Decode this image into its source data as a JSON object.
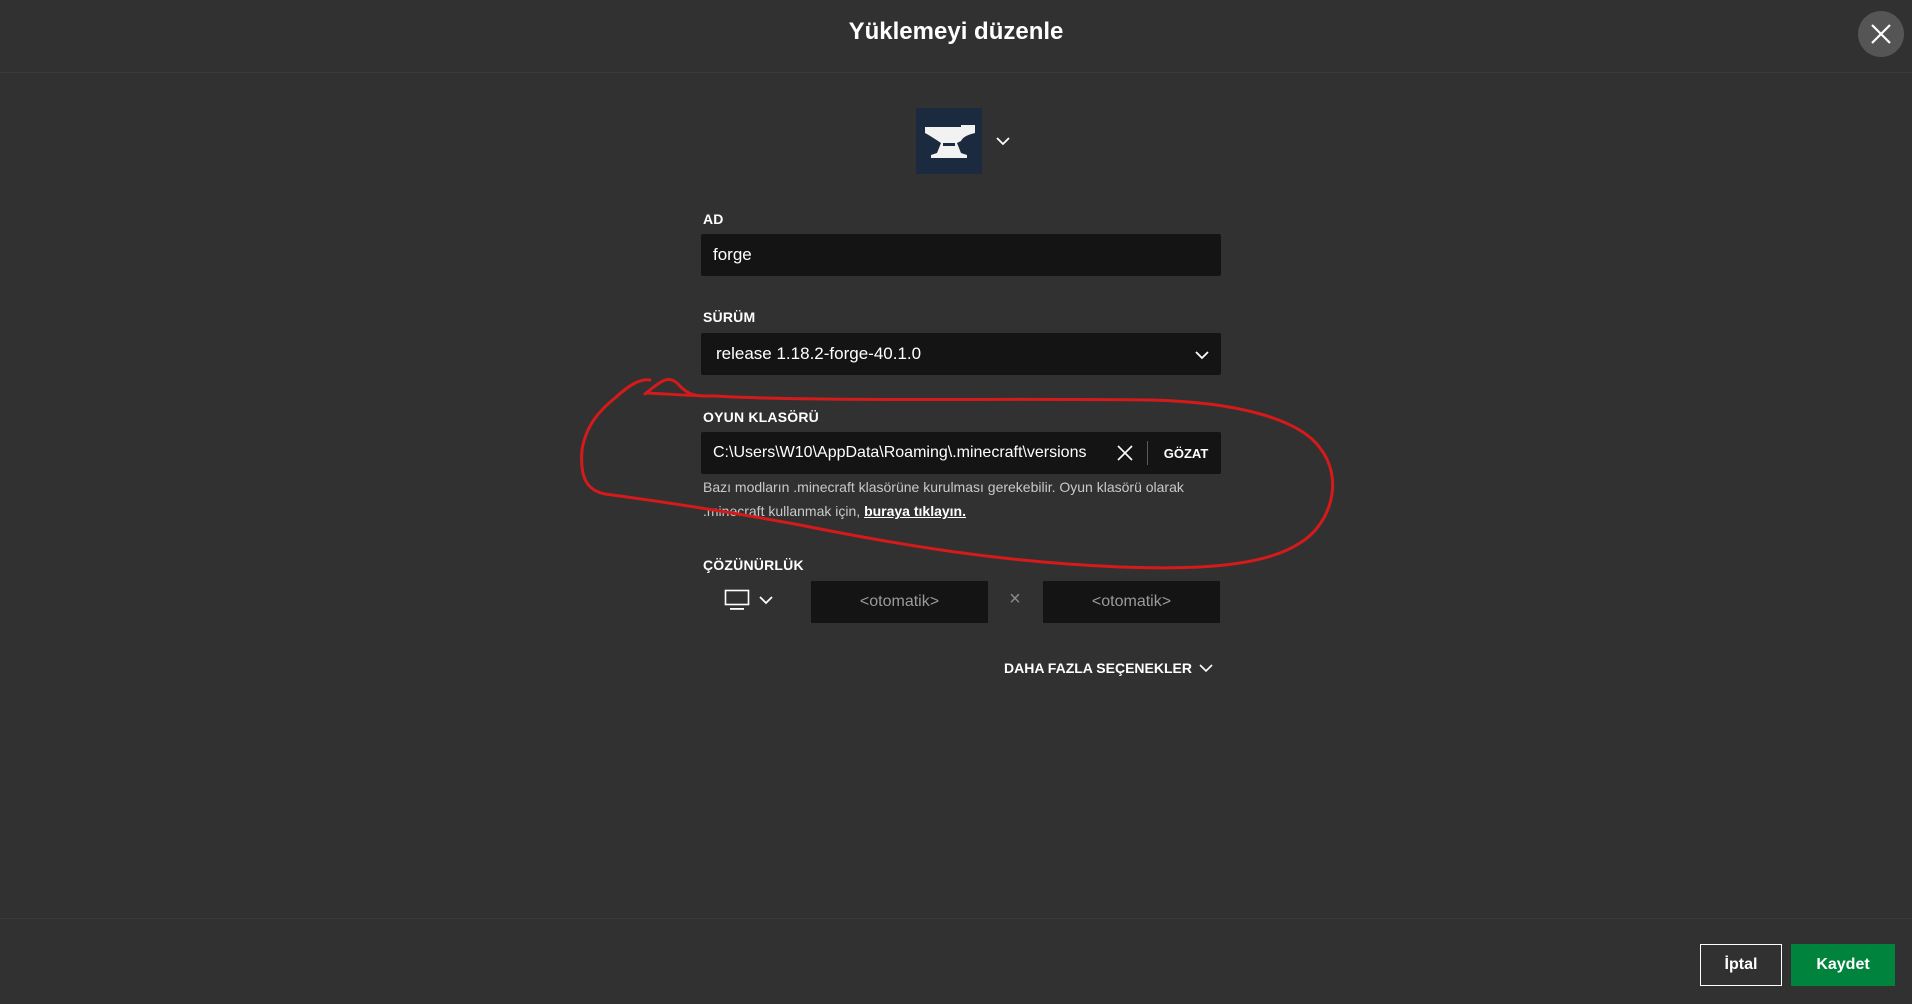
{
  "header": {
    "title": "Yüklemeyi düzenle",
    "close_icon": "close-icon"
  },
  "icon_picker": {
    "icon": "anvil-icon",
    "chevron": "chevron-down-icon"
  },
  "name_field": {
    "label": "AD",
    "value": "forge"
  },
  "version_field": {
    "label": "SÜRÜM",
    "value": "release 1.18.2-forge-40.1.0"
  },
  "game_dir_field": {
    "label": "OYUN KLASÖRÜ",
    "value": "C:\\Users\\W10\\AppData\\Roaming\\.minecraft\\versions",
    "browse_label": "GÖZAT",
    "hint_text": "Bazı modların .minecraft klasörüne kurulması gerekebilir. Oyun klasörü olarak .minecraft kullanmak için,",
    "hint_link": "buraya tıklayın."
  },
  "resolution": {
    "label": "ÇÖZÜNÜRLÜK",
    "monitor_icon": "monitor-icon",
    "width_placeholder": "<otomatik>",
    "separator": "×",
    "height_placeholder": "<otomatik>"
  },
  "more_options": {
    "label": "DAHA FAZLA SEÇENEKLER"
  },
  "footer": {
    "cancel_label": "İptal",
    "save_label": "Kaydet"
  },
  "colors": {
    "background": "#313131",
    "field_background": "#141414",
    "save_button": "#00843d",
    "annotation_stroke": "#d41a1a"
  }
}
